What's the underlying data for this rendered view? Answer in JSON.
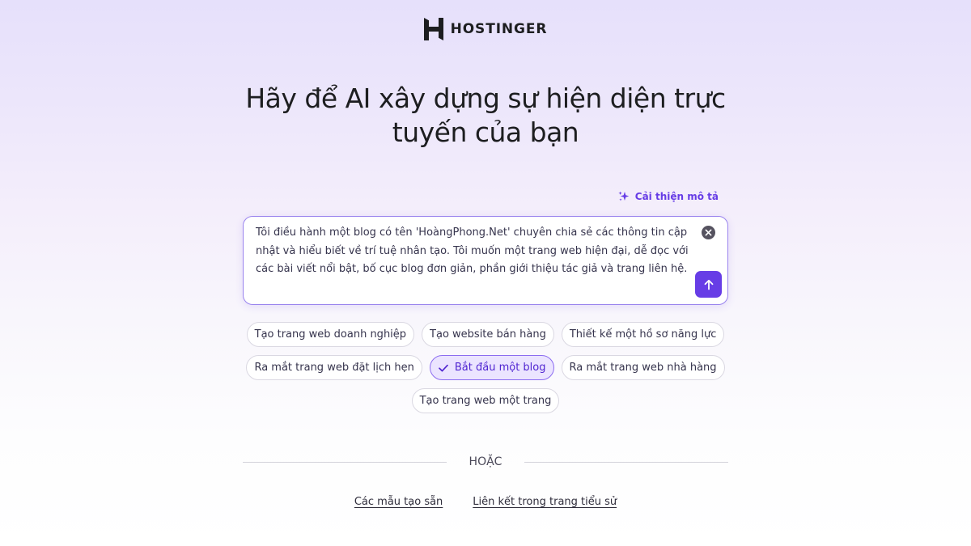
{
  "brand": {
    "name": "HOSTINGER",
    "logo_icon": "hostinger-h-logo",
    "color": "#1d1e20"
  },
  "hero": {
    "headline_line1": "Hãy để AI xây dựng sự hiện diện trực",
    "headline_line2": "tuyến của bạn"
  },
  "improve": {
    "label": "Cải thiện mô tả",
    "icon": "sparkle-icon",
    "color": "#673de6"
  },
  "prompt": {
    "value": "Tôi điều hành một blog có tên 'HoàngPhong.Net' chuyên chia sẻ các thông tin cập nhật và hiểu biết về trí tuệ nhân tạo. Tôi muốn một trang web hiện đại, dễ đọc với các bài viết nổi bật, bố cục blog đơn giản, phần giới thiệu tác giả và trang liên hệ.",
    "clear_icon": "close-circle-icon",
    "send_icon": "arrow-up-icon",
    "accent": "#673de6"
  },
  "suggestions": [
    [
      {
        "label": "Tạo trang web doanh nghiệp",
        "selected": false
      },
      {
        "label": "Tạo website bán hàng",
        "selected": false
      },
      {
        "label": "Thiết kế một hồ sơ năng lực",
        "selected": false
      }
    ],
    [
      {
        "label": "Ra mắt trang web đặt lịch hẹn",
        "selected": false
      },
      {
        "label": "Bắt đầu một blog",
        "selected": true
      },
      {
        "label": "Ra mắt trang web nhà hàng",
        "selected": false
      }
    ],
    [
      {
        "label": "Tạo trang web một trang",
        "selected": false
      }
    ]
  ],
  "divider": {
    "label": "HOẶC"
  },
  "links": {
    "templates": "Các mẫu tạo sẵn",
    "bio_link": "Liên kết trong trang tiểu sử"
  }
}
